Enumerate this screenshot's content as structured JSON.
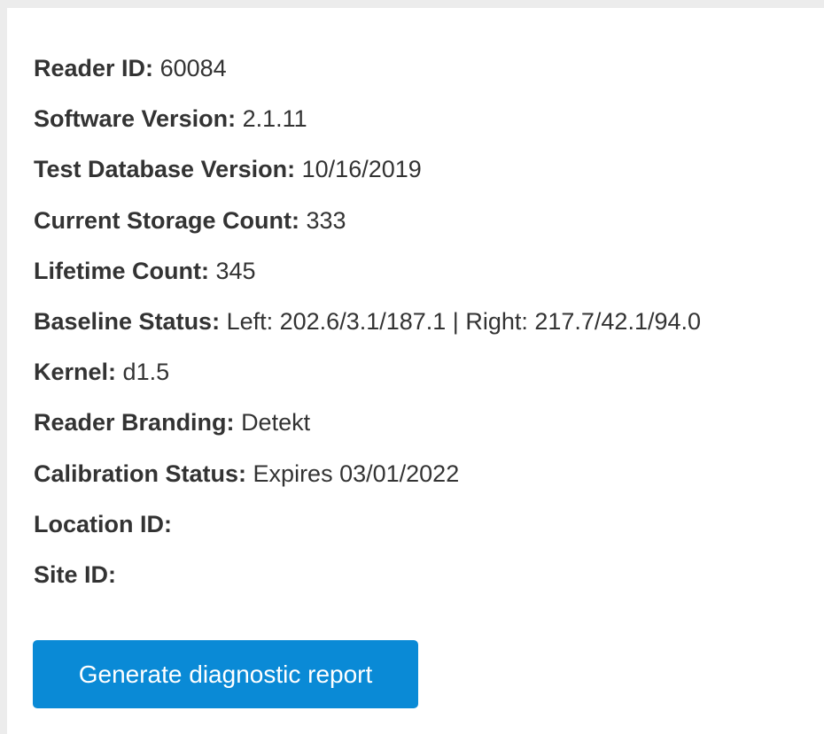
{
  "device_info": {
    "rows": [
      {
        "label": "Reader ID:",
        "value": "60084"
      },
      {
        "label": "Software Version:",
        "value": "2.1.11"
      },
      {
        "label": "Test Database Version:",
        "value": "10/16/2019"
      },
      {
        "label": "Current Storage Count:",
        "value": "333"
      },
      {
        "label": "Lifetime Count:",
        "value": "345"
      },
      {
        "label": "Baseline Status:",
        "value": "Left: 202.6/3.1/187.1 | Right: 217.7/42.1/94.0"
      },
      {
        "label": "Kernel:",
        "value": "d1.5"
      },
      {
        "label": "Reader Branding:",
        "value": "Detekt"
      },
      {
        "label": "Calibration Status:",
        "value": "Expires 03/01/2022"
      },
      {
        "label": "Location ID:",
        "value": ""
      },
      {
        "label": "Site ID:",
        "value": ""
      }
    ]
  },
  "actions": {
    "generate_report_label": "Generate diagnostic report"
  },
  "colors": {
    "page_background": "#ececec",
    "panel_background": "#ffffff",
    "text": "#333333",
    "button_background": "#0a8ad6",
    "button_text": "#ffffff"
  }
}
